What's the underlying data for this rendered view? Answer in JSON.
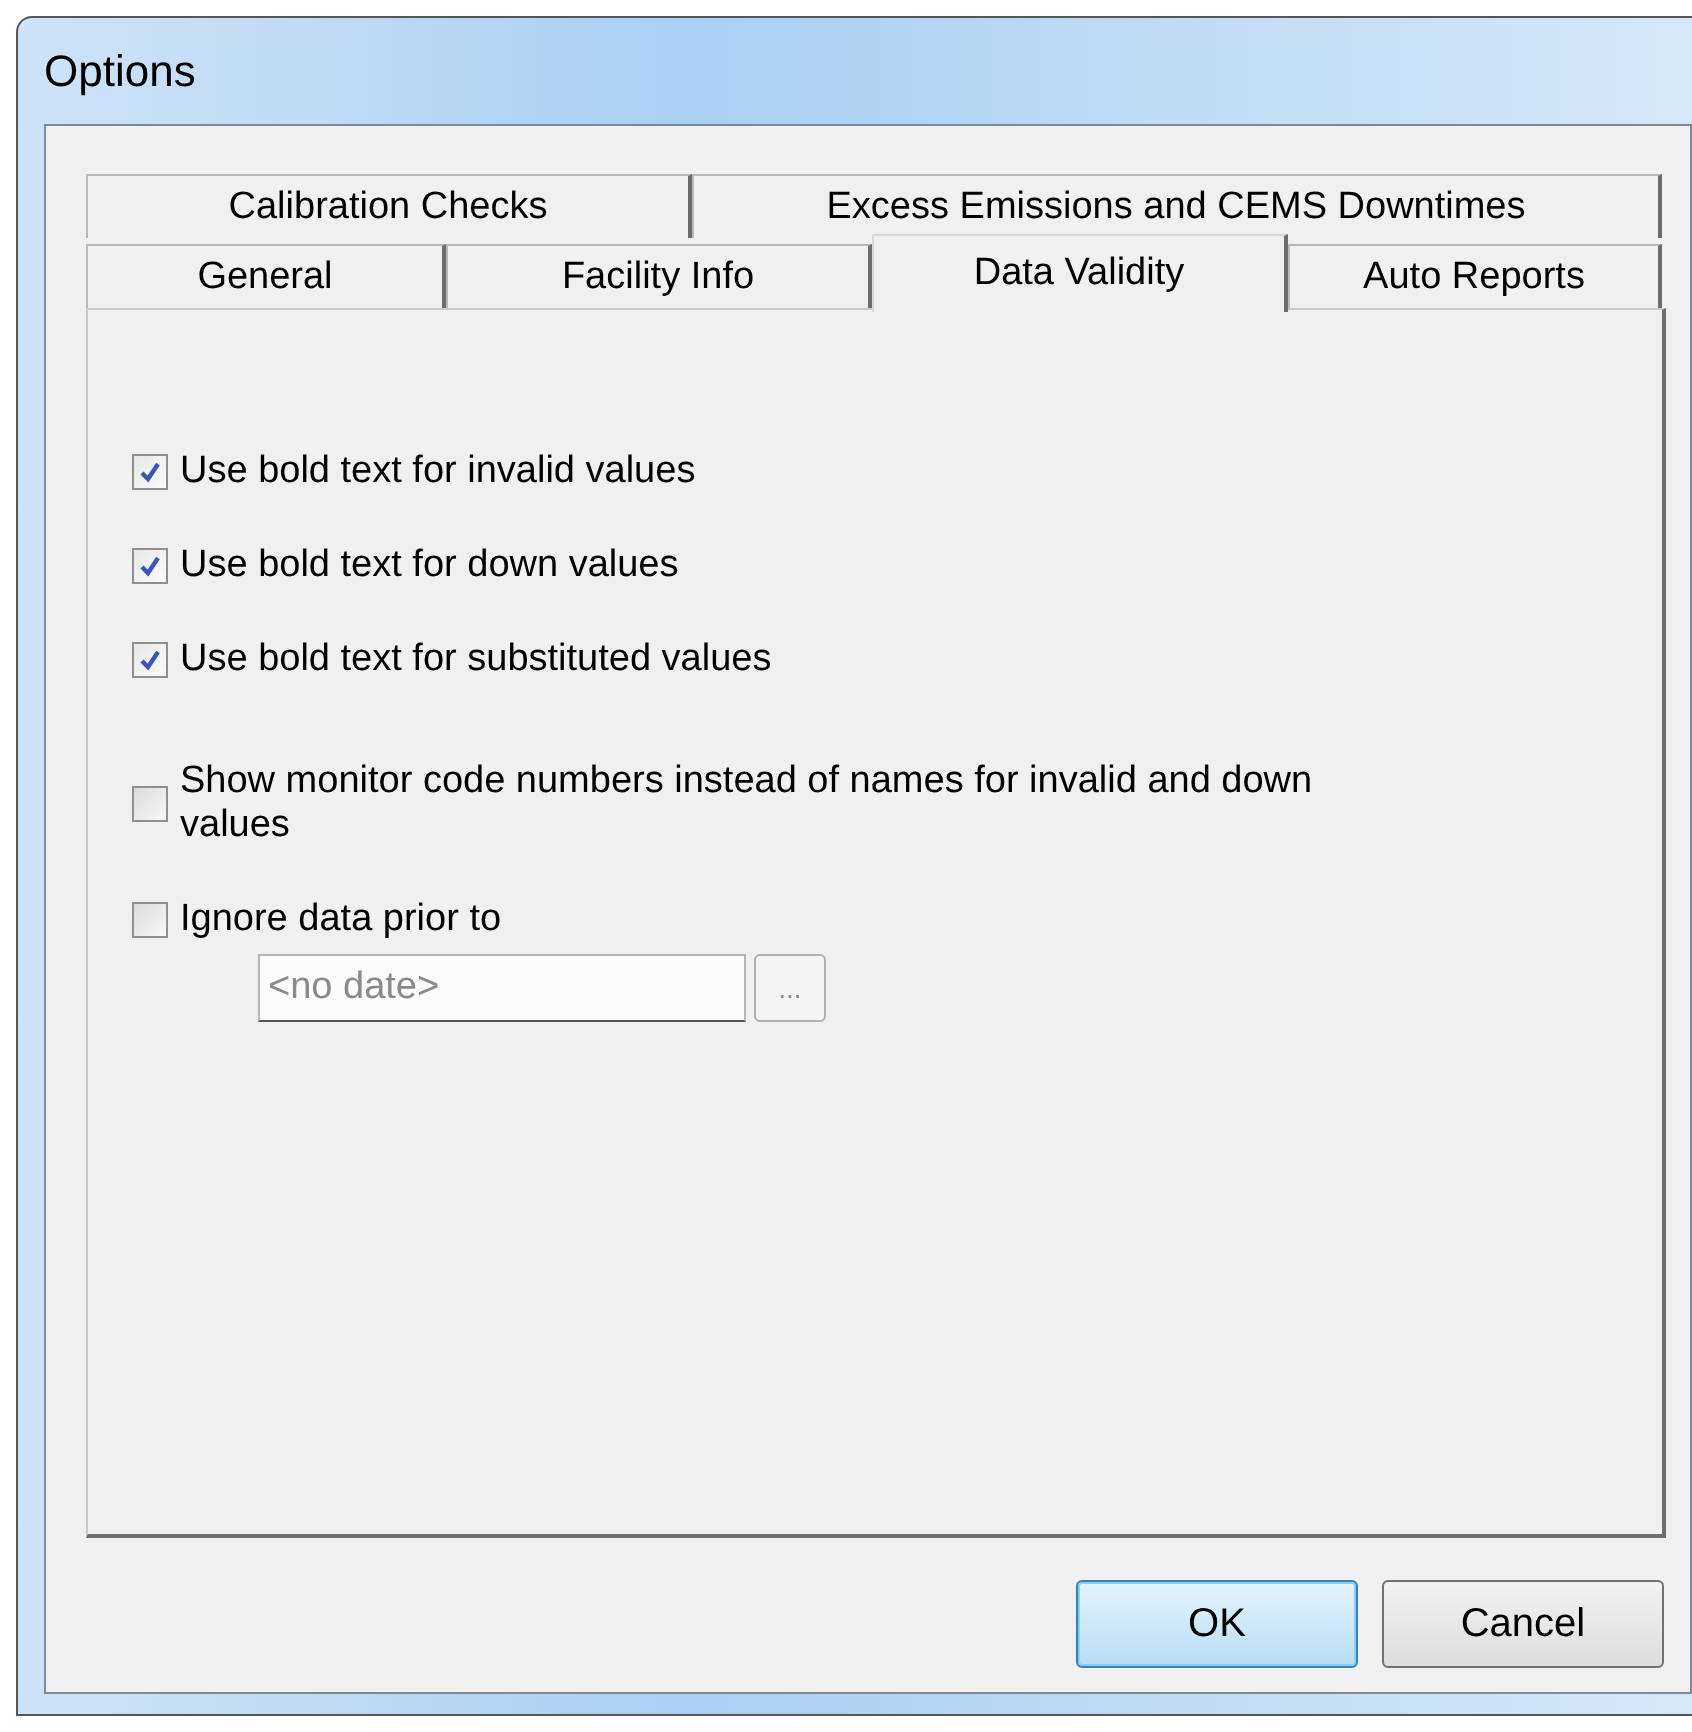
{
  "window": {
    "title": "Options"
  },
  "tab_rows": [
    [
      {
        "label": "Calibration Checks",
        "selected": false
      },
      {
        "label": "Excess Emissions and CEMS Downtimes",
        "selected": false
      }
    ],
    [
      {
        "label": "General",
        "selected": false
      },
      {
        "label": "Facility Info",
        "selected": false
      },
      {
        "label": "Data Validity",
        "selected": true
      },
      {
        "label": "Auto Reports",
        "selected": false
      }
    ]
  ],
  "options": [
    {
      "label": "Use bold text for invalid values",
      "checked": true
    },
    {
      "label": "Use bold text for down values",
      "checked": true
    },
    {
      "label": "Use bold text for substituted values",
      "checked": true
    },
    {
      "label": "Show monitor code numbers instead of names for invalid and down values",
      "checked": false
    },
    {
      "label": "Ignore data prior to",
      "checked": false
    }
  ],
  "date_field": {
    "placeholder": "<no date>",
    "disabled": true,
    "browse_button": "..."
  },
  "buttons": [
    {
      "label": "OK",
      "default": true
    },
    {
      "label": "Cancel",
      "default": false
    }
  ]
}
